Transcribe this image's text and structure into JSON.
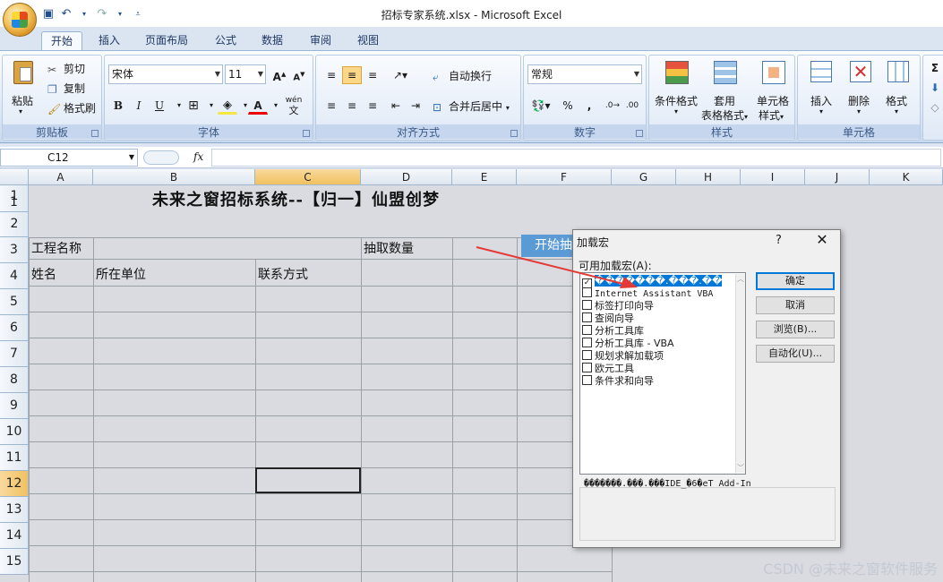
{
  "window": {
    "title": "招标专家系统.xlsx - Microsoft Excel"
  },
  "tabs": [
    "开始",
    "插入",
    "页面布局",
    "公式",
    "数据",
    "审阅",
    "视图"
  ],
  "ribbon": {
    "clipboard": {
      "label": "剪贴板",
      "paste": "粘贴",
      "cut": "剪切",
      "copy": "复制",
      "format_painter": "格式刷"
    },
    "font": {
      "label": "字体",
      "family": "宋体",
      "size": "11",
      "bold": "B",
      "italic": "I",
      "underline": "U",
      "wen": "wén",
      "wen_char": "文"
    },
    "alignment": {
      "label": "对齐方式",
      "wrap": "自动换行",
      "merge": "合并后居中"
    },
    "number": {
      "label": "数字",
      "format": "常规",
      "percent": "%",
      "comma": ","
    },
    "styles": {
      "label": "样式",
      "conditional": "条件格式",
      "table": "套用",
      "table2": "表格格式",
      "cell_style": "单元格",
      "cell_style2": "样式"
    },
    "cells": {
      "label": "单元格",
      "insert": "插入",
      "delete": "删除",
      "format": "格式"
    }
  },
  "formula_bar": {
    "name_box": "C12",
    "fx": "fx",
    "value": ""
  },
  "columns": [
    "A",
    "B",
    "C",
    "D",
    "E",
    "F",
    "G",
    "H",
    "I",
    "J",
    "K"
  ],
  "rows": [
    "1",
    "2",
    "3",
    "4",
    "5",
    "6",
    "7",
    "8",
    "9",
    "10",
    "11",
    "12",
    "13",
    "14",
    "15"
  ],
  "sheet": {
    "title": "未来之窗招标系统--【归一】仙盟创梦",
    "project_label": "工程名称",
    "draw_count_label": "抽取数量",
    "start_button": "开始抽取",
    "name_header": "姓名",
    "unit_header": "所在单位",
    "contact_header": "联系方式"
  },
  "dialog": {
    "title": "加载宏",
    "help": "?",
    "close": "✕",
    "list_label": "可用加载宏(A):",
    "items": [
      {
        "label": "�������.���.��",
        "checked": true
      },
      {
        "label": "Internet Assistant VBA",
        "checked": false
      },
      {
        "label": "标签打印向导",
        "checked": false
      },
      {
        "label": "查阅向导",
        "checked": false
      },
      {
        "label": "分析工具库",
        "checked": false
      },
      {
        "label": "分析工具库 - VBA",
        "checked": false
      },
      {
        "label": "规划求解加载项",
        "checked": false
      },
      {
        "label": "欧元工具",
        "checked": false
      },
      {
        "label": "条件求和向导",
        "checked": false
      }
    ],
    "buttons": {
      "ok": "确定",
      "cancel": "取消",
      "browse": "浏览(B)...",
      "automation": "自动化(U)..."
    },
    "description_title": "�������.���.���IDE_�6�eT Add-In"
  },
  "watermark": "CSDN @未来之窗软件服务",
  "colors": {
    "accent": "#5b9bd5",
    "selection": "#0078d7",
    "arrow": "#e53935"
  }
}
